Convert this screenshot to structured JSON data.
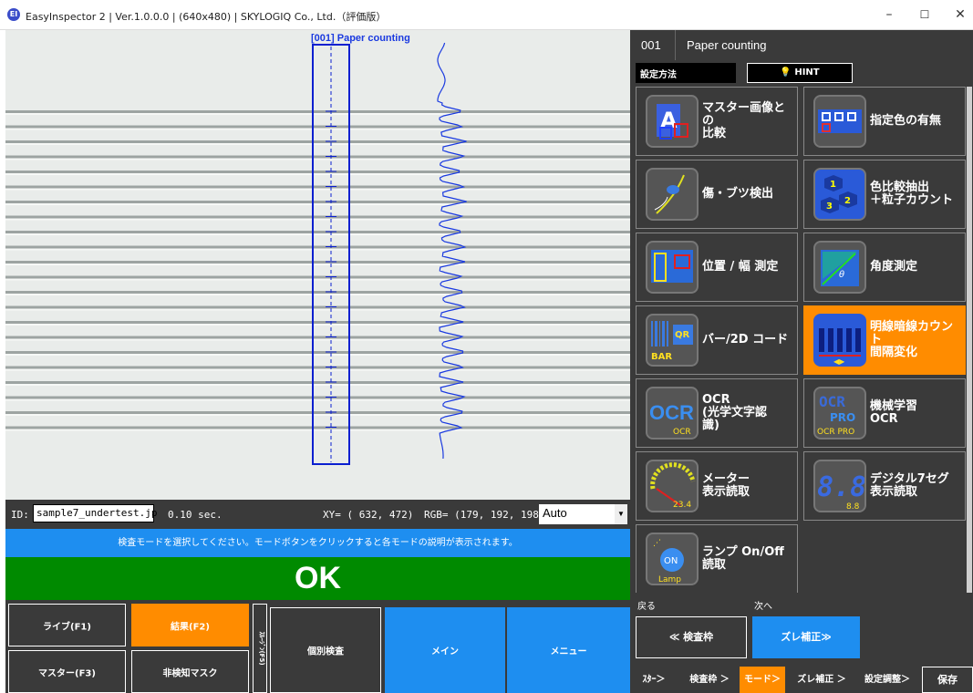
{
  "window": {
    "title": "EasyInspector 2 | Ver.1.0.0.0 | (640x480) | SKYLOGIQ Co., Ltd.（評価版）",
    "minimize": "–",
    "maximize": "☐",
    "close": "✕"
  },
  "camera": {
    "roi_label": "[001] Paper counting"
  },
  "info_bar": {
    "id_label": "ID:",
    "filename": "sample7_undertest.jp",
    "time": "0.10 sec.",
    "xy": "XY= ( 632,  472)",
    "rgb": "RGB= (179, 192, 198)",
    "mode_select": "Auto"
  },
  "message": "検査モードを選択してください。モードボタンをクリックすると各モードの説明が表示されます。",
  "result": "OK",
  "left_buttons": {
    "live": "ライブ(F1)",
    "result": "結果(F2)",
    "master": "マスター(F3)",
    "nodetect_mask": "非検知マスク",
    "narrow": "ｽﾙｰｼﾞﾝ(F5)",
    "individual": "個別検査",
    "main": "メイン",
    "menu": "メニュー"
  },
  "panel": {
    "number": "001",
    "name": "Paper counting",
    "setting_label": "設定方法",
    "hint": "HINT"
  },
  "modes": [
    {
      "label": "マスター画像との\n比較",
      "icon": "master-compare-icon"
    },
    {
      "label": "指定色の有無",
      "icon": "color-presence-icon"
    },
    {
      "label": "傷・ブツ検出",
      "icon": "scratch-detect-icon"
    },
    {
      "label": "色比較抽出\n＋粒子カウント",
      "icon": "particle-count-icon"
    },
    {
      "label": "位置 / 幅 測定",
      "icon": "position-width-icon"
    },
    {
      "label": "角度測定",
      "icon": "angle-measure-icon"
    },
    {
      "label": "バー/2D コード",
      "icon": "barcode-icon"
    },
    {
      "label": "明線暗線カウント\n間隔変化",
      "icon": "line-count-icon"
    },
    {
      "label": "OCR\n(光学文字認\n識)",
      "icon": "ocr-icon"
    },
    {
      "label": "機械学習\nOCR",
      "icon": "ocr-pro-icon"
    },
    {
      "label": "メーター\n表示読取",
      "icon": "meter-icon"
    },
    {
      "label": "デジタル7セグ\n表示読取",
      "icon": "seven-seg-icon"
    },
    {
      "label": "ランプ On/Off\n読取",
      "icon": "lamp-icon"
    }
  ],
  "icon_text": {
    "qr": "QR",
    "bar": "BAR",
    "ocr": "OCR",
    "ocr_small": "OCR",
    "ocr_pro_big": "OCR",
    "pro": "PRO",
    "ocr_pro": "OCR PRO",
    "meter_val": "23.4",
    "seg": "8.8",
    "seg_small": "8.8",
    "on": "ON",
    "lamp": "Lamp",
    "p1": "1",
    "p2": "2",
    "p3": "3"
  },
  "nav": {
    "back_label": "戻る",
    "next_label": "次へ",
    "back_button": "≪ 検査枠",
    "next_button": "ズレ補正≫",
    "steps": [
      "ｽﾀｰ＞",
      "検査枠 ＞",
      "モード＞",
      "ズレ補正 ＞",
      "設定調整＞"
    ],
    "save": "保存"
  },
  "colors": {
    "accent_orange": "#ff8c00",
    "accent_blue": "#1e8ef0",
    "ok_green": "#008a00",
    "panel_bg": "#3a3a3a"
  }
}
